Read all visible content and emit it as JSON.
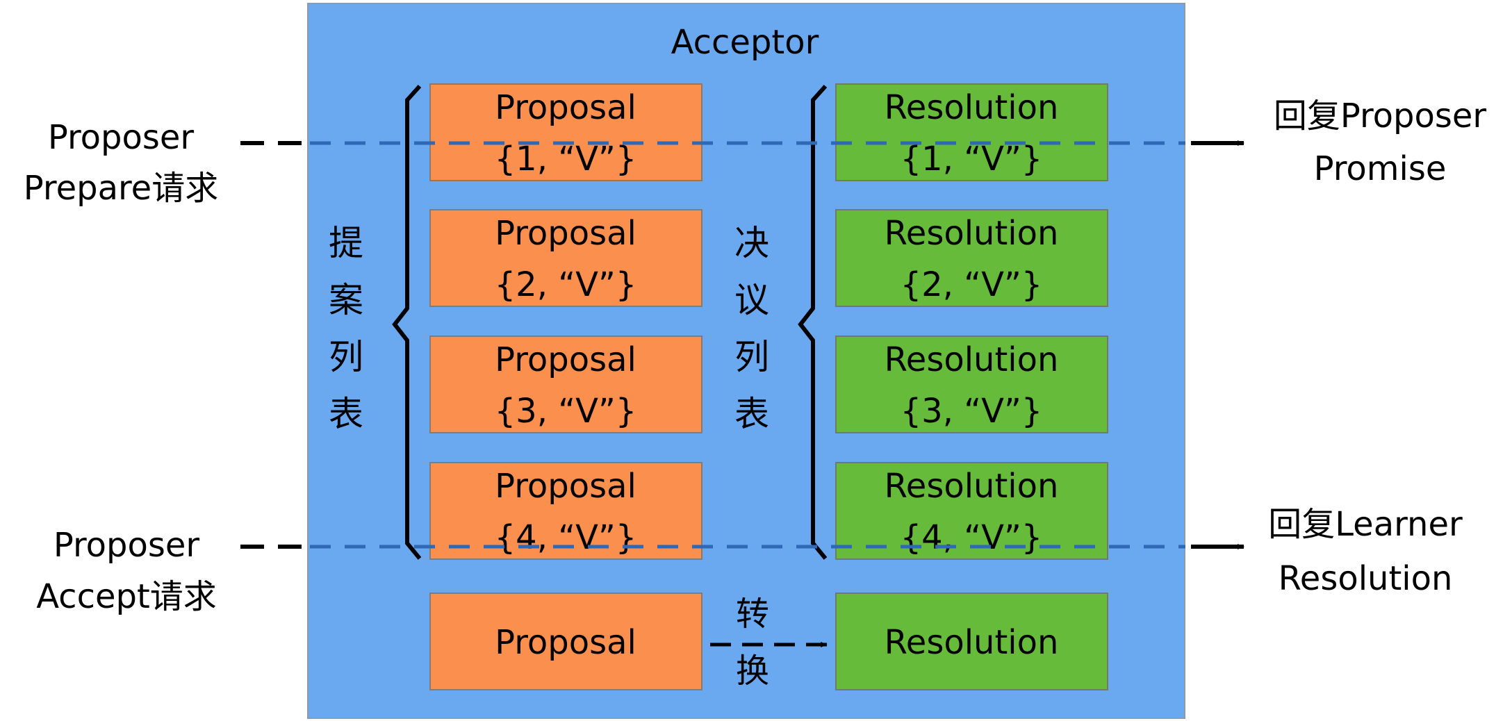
{
  "acceptor": {
    "title": "Acceptor"
  },
  "colors": {
    "acceptor_fill": "#6aa9f0",
    "proposal_fill": "#fb8f4e",
    "resolution_fill": "#66bb3a",
    "dashed_line": "#2f68b5"
  },
  "inputs": {
    "prepare": {
      "line1": "Proposer",
      "line2": "Prepare请求"
    },
    "accept": {
      "line1": "Proposer",
      "line2": "Accept请求"
    }
  },
  "outputs": {
    "promise": {
      "line1": "回复Proposer",
      "line2": "Promise"
    },
    "resolution": {
      "line1": "回复Learner",
      "line2": "Resolution"
    }
  },
  "proposal_list": {
    "label_chars": [
      "提",
      "案",
      "列",
      "表"
    ],
    "items": [
      {
        "title": "Proposal",
        "value": "{1, “V”}"
      },
      {
        "title": "Proposal",
        "value": "{2, “V”}"
      },
      {
        "title": "Proposal",
        "value": "{3, “V”}"
      },
      {
        "title": "Proposal",
        "value": "{4, “V”}"
      }
    ]
  },
  "resolution_list": {
    "label_chars": [
      "决",
      "议",
      "列",
      "表"
    ],
    "items": [
      {
        "title": "Resolution",
        "value": "{1, “V”}"
      },
      {
        "title": "Resolution",
        "value": "{2, “V”}"
      },
      {
        "title": "Resolution",
        "value": "{3, “V”}"
      },
      {
        "title": "Resolution",
        "value": "{4, “V”}"
      }
    ]
  },
  "conversion": {
    "from": "Proposal",
    "to": "Resolution",
    "label_chars": [
      "转",
      "换"
    ]
  }
}
